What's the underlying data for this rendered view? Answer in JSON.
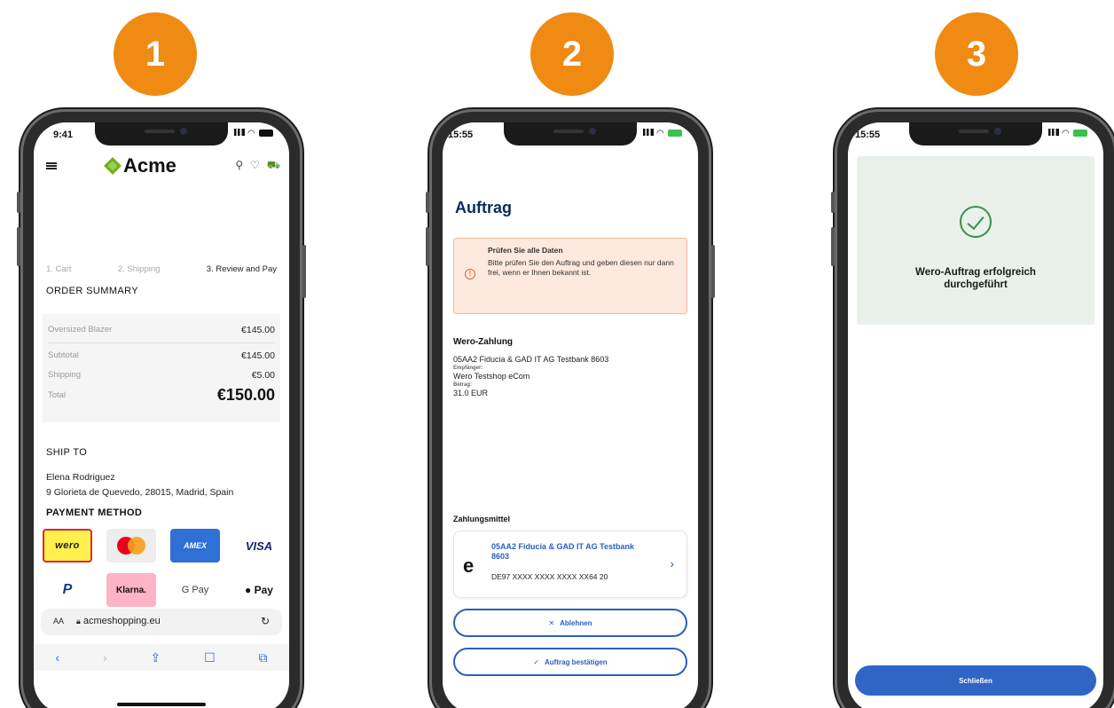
{
  "steps": [
    "1",
    "2",
    "3"
  ],
  "phone1": {
    "time": "9:41",
    "brand": "Acme",
    "checkout_steps": [
      "1. Cart",
      "2. Shipping",
      "3. Review and Pay"
    ],
    "order_summary_title": "ORDER SUMMARY",
    "item": {
      "name": "Oversized Blazer",
      "price": "€145.00"
    },
    "subtotal": {
      "label": "Subtotal",
      "value": "€145.00"
    },
    "shipping": {
      "label": "Shipping",
      "value": "€5.00"
    },
    "total": {
      "label": "Total",
      "value": "€150.00"
    },
    "ship_to_title": "SHIP TO",
    "ship_name": "Elena Rodriguez",
    "ship_address": "9 Glorieta de Quevedo, 28015, Madrid, Spain",
    "payment_method_title": "PAYMENT METHOD",
    "payment_methods": [
      "wero",
      "Mastercard",
      "AMEX",
      "VISA",
      "PayPal",
      "Klarna.",
      "G Pay",
      "Pay"
    ],
    "url_aa": "AA",
    "url": "acmeshopping.eu"
  },
  "phone2": {
    "time": "15:55",
    "title": "Auftrag",
    "alert_title": "Prüfen Sie alle Daten",
    "alert_text": "Bitte prüfen Sie den Auftrag und geben diesen nur dann frei, wenn er Ihnen bekannt ist.",
    "payment_section": "Wero-Zahlung",
    "bank_line": "05AA2 Fiducia & GAD IT AG Testbank 8603",
    "recipient_label": "Empfänger:",
    "recipient": "Wero Testshop eCom",
    "amount_label": "Betrag:",
    "amount": "31.0 EUR",
    "means_section": "Zahlungsmittel",
    "account_name": "05AA2 Fiducia & GAD IT AG Testbank 8603",
    "account_iban": "DE97 XXXX XXXX XXXX XX64 20",
    "reject_label": "Ablehnen",
    "confirm_label": "Auftrag bestätigen"
  },
  "phone3": {
    "time": "15:55",
    "message": "Wero-Auftrag erfolgreich durchgeführt",
    "close_label": "Schließen"
  },
  "colors": {
    "badge": "#ef8a12",
    "wero_blue": "#2f65c5",
    "success_green": "#3e8e4a"
  }
}
